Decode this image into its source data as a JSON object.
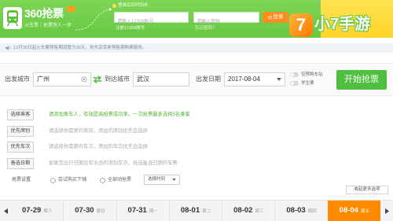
{
  "header": {
    "logo_text": "360抢票",
    "slogan": "火车票｜抢票快人一步",
    "icon": "train-icon"
  },
  "login": {
    "sync_label": "登录后实时同步",
    "account_placeholder": "请输入12306账号",
    "password_placeholder": "请输入密码",
    "register_link": "注册12306账号",
    "forgot_link": "忘记密码？",
    "login_button": "登录"
  },
  "watermark": {
    "icon_text": "7",
    "text": "小7手游"
  },
  "notice": {
    "icon": "speaker-icon",
    "text": "12月30日起火车票预售期调整为30天，抢先享受新预售期购票服务。"
  },
  "search": {
    "from_label": "出发城市",
    "from_value": "广州",
    "to_label": "到达城市",
    "to_value": "武汉",
    "date_label": "出发日期",
    "date_value": "2017-08-04",
    "toggles": [
      {
        "label": "仅预购车站",
        "on": false
      },
      {
        "label": "学生票",
        "on": false
      }
    ],
    "start_button": "开始抢票"
  },
  "options": [
    {
      "button": "选择乘客",
      "hint": "请添加乘车人，有效提高抢票成功率。一次抢票最多选择5名乘客"
    },
    {
      "button": "优先席别",
      "hint": "请选择你需要的席别，添加的席别优先会选择"
    },
    {
      "button": "优先车次",
      "hint": "请选择你需要的车次，添加的车次优先会选择"
    },
    {
      "button": "备选日期",
      "hint": "如果您出行日期没有合适的席别车次，抢选备选日期的车票"
    }
  ],
  "settings": {
    "label": "抢票设置",
    "radio_1": "尝试购买下铺",
    "radio_2": "全部动抢票",
    "select_value": "选择时间"
  },
  "toggle_more": "收起更多选项",
  "dates": [
    {
      "date": "07-29",
      "weekday": "周六"
    },
    {
      "date": "07-30",
      "weekday": "周日"
    },
    {
      "date": "07-31",
      "weekday": "周一"
    },
    {
      "date": "08-01",
      "weekday": "周二"
    },
    {
      "date": "08-02",
      "weekday": "周三"
    },
    {
      "date": "08-03",
      "weekday": "周四"
    },
    {
      "date": "08-04",
      "weekday": "周五"
    }
  ],
  "selected_date_index": 6,
  "colors": {
    "header_green": "#66c843",
    "header_green_light": "#7ed657",
    "accent_orange": "#ff8a00",
    "button_green": "#4fbf3f",
    "hint_green": "#55b236",
    "notice_text": "#7b8da3",
    "watermark_yellow": "#ffd42a",
    "login_orange": "#ff8d1f"
  }
}
